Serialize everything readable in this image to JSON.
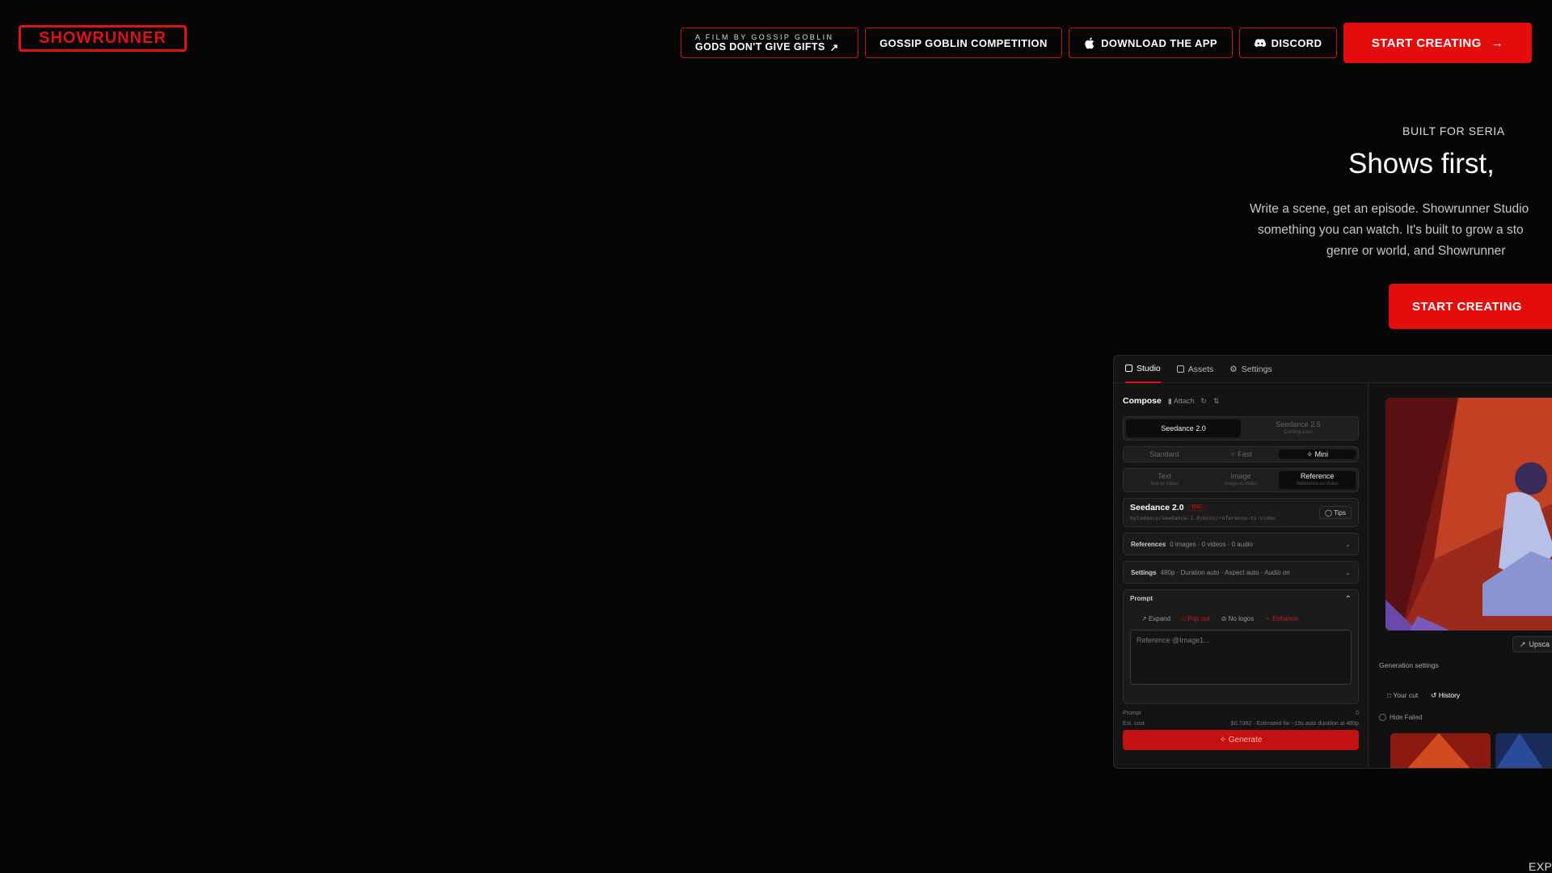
{
  "header": {
    "logo": "SHOWRUNNER",
    "film_small": "A FILM BY GOSSIP GOBLIN",
    "film_title": "GODS DON'T GIVE GIFTS",
    "competition": "GOSSIP GOBLIN COMPETITION",
    "download": "DOWNLOAD THE APP",
    "discord": "DISCORD",
    "cta": "START CREATING"
  },
  "hero": {
    "tagline": "BUILT FOR SERIA",
    "headline": "Shows first,",
    "desc_line1": "Write a scene, get an episode. Showrunner Studio",
    "desc_line2": "something you can watch. It's built to grow a sto",
    "desc_line3": "genre or world, and Showrunner",
    "cta": "START CREATING",
    "explore": "EXPLORE"
  },
  "app": {
    "tabs": [
      "Studio",
      "Assets",
      "Settings"
    ],
    "compose": "Compose",
    "attach": "Attach",
    "models": [
      {
        "label": "Seedance 2.0",
        "sub": ""
      },
      {
        "label": "Seedance 2.5",
        "sub": "Coming soon"
      }
    ],
    "speeds": [
      "Standard",
      "Fast",
      "Mini"
    ],
    "types": [
      {
        "label": "Text",
        "sub": "Text-to-Video"
      },
      {
        "label": "Image",
        "sub": "Image-to-Video"
      },
      {
        "label": "Reference",
        "sub": "Reference-to-Video"
      }
    ],
    "model_name": "Seedance 2.0",
    "model_badge": "Mini",
    "model_path": "bytedance/seedance-2.0/mini/reference-to-video",
    "tips": "Tips",
    "references_label": "References",
    "references_value": "0 images · 0 videos · 0 audio",
    "settings_label": "Settings",
    "settings_value": "480p · Duration auto · Aspect auto · Audio on",
    "prompt_label": "Prompt",
    "prompt_tools": [
      "Expand",
      "Pop out",
      "No logos",
      "Enhance"
    ],
    "prompt_placeholder": "Reference @Image1...",
    "prompt_count_label": "Prompt",
    "prompt_count": "0",
    "est_label": "Est. cost",
    "est_value": "$0.7382 · Estimated for ~15s auto duration at 480p",
    "generate": "Generate",
    "upscale": "Upsca",
    "generation_settings": "Generation settings",
    "your_cut": "Your cut",
    "history": "History",
    "hide_failed": "Hide Failed"
  },
  "colors": {
    "accent": "#e30d0d",
    "background": "#050505"
  }
}
